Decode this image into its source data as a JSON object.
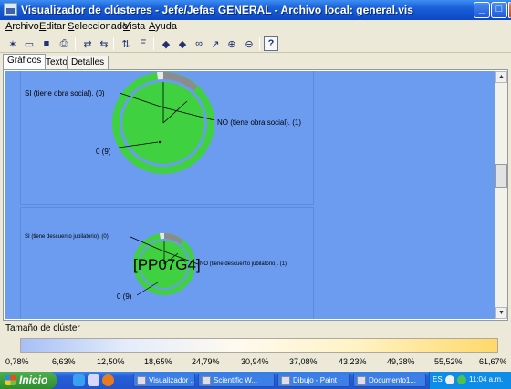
{
  "window": {
    "title": "Visualizador de clústeres - Jefe/Jefas GENERAL - Archivo local: general.vis"
  },
  "menu": [
    "Archivo",
    "Editar",
    "Seleccionado",
    "Vista",
    "Ayuda"
  ],
  "toolbar": {
    "icons": [
      "new-icon",
      "open-icon",
      "save-icon",
      "print-icon",
      "swap-icon",
      "swap-back-icon",
      "sort-icon",
      "filter-icon",
      "arrow-left-icon",
      "arrow-right-icon",
      "binoculars-icon",
      "select-icon",
      "zoom-in-icon",
      "zoom-out-icon",
      "help-icon"
    ]
  },
  "tabs": [
    "Gráficos",
    "Texto",
    "Detalles"
  ],
  "clusters": [
    {
      "name": "",
      "labels": {
        "si": "SI (tiene obra social). (0)",
        "no": "NO (tiene obra social). (1)",
        "zero": "0 (9)"
      },
      "slices": [
        {
          "label": "0",
          "fraction": 0.91,
          "color": "#3fd13f"
        },
        {
          "label": "NO",
          "fraction": 0.09,
          "color": "#8c8c8c"
        }
      ]
    },
    {
      "name": "[PP07G4]",
      "labels": {
        "si": "SI (tiene descuento jubilatorio). (0)",
        "no": "NO (tiene descuento jubilatorio). (1)",
        "zero": "0 (9)"
      },
      "slices": [
        {
          "label": "0",
          "fraction": 0.9,
          "color": "#3fd13f"
        },
        {
          "label": "NO",
          "fraction": 0.1,
          "color": "#8c8c8c"
        }
      ]
    }
  ],
  "legend": {
    "title": "Tamaño de clúster",
    "ticks": [
      "0,78%",
      "6,63%",
      "12,50%",
      "18,65%",
      "24,79%",
      "30,94%",
      "37,08%",
      "43,23%",
      "49,38%",
      "55,52%",
      "61,67%"
    ]
  },
  "taskbar": {
    "start_label": "Inicio",
    "tasks": [
      "Visualizador ...",
      "Scientific W...",
      "Dibujo - Paint",
      "Documento1..."
    ],
    "tray_lang": "ES",
    "clock": "11:04 a.m."
  },
  "colors": {
    "background": "#6b9cf0",
    "pie_primary": "#3fd13f",
    "pie_secondary": "#8c8c8c"
  }
}
